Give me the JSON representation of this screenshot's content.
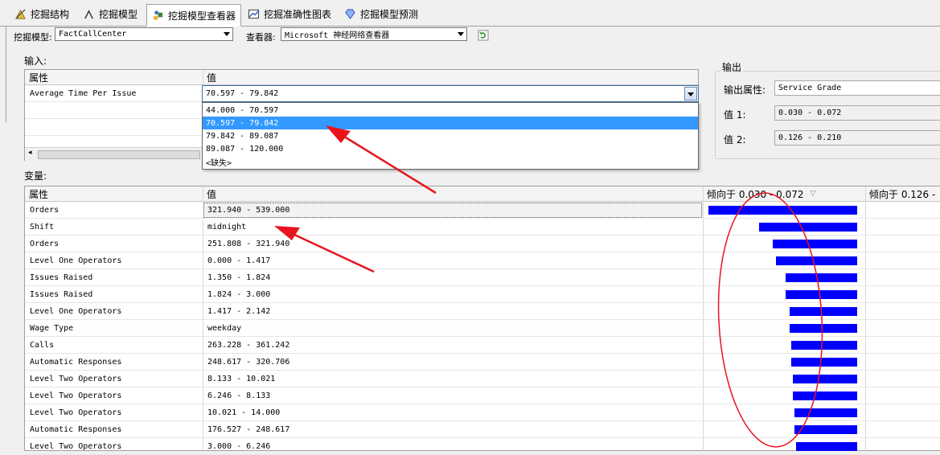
{
  "tabs": [
    {
      "label": "挖掘结构",
      "icon": "structure-icon"
    },
    {
      "label": "挖掘模型",
      "icon": "model-icon"
    },
    {
      "label": "挖掘模型查看器",
      "icon": "viewer-icon"
    },
    {
      "label": "挖掘准确性图表",
      "icon": "chart-icon"
    },
    {
      "label": "挖掘模型预测",
      "icon": "prediction-icon"
    }
  ],
  "toolbar": {
    "model_label": "挖掘模型:",
    "model_value": "FactCallCenter",
    "viewer_label": "查看器:",
    "viewer_value": "Microsoft 神经网络查看器"
  },
  "input": {
    "section_label": "输入:",
    "col_attr": "属性",
    "col_value": "值",
    "rows": [
      {
        "attr": "Average Time Per Issue",
        "value": "70.597 - 79.842"
      }
    ],
    "dropdown_options": [
      "44.000 - 70.597",
      "70.597 - 79.842",
      "79.842 - 89.087",
      "89.087 - 120.000",
      "<缺失>"
    ],
    "dropdown_selected_index": 1
  },
  "output": {
    "section_label": "输出",
    "attr_label": "输出属性:",
    "attr_value": "Service Grade",
    "value1_label": "值 1:",
    "value1": "0.030 - 0.072",
    "value2_label": "值 2:",
    "value2": "0.126 - 0.210"
  },
  "variables": {
    "section_label": "变量:",
    "col_attr": "属性",
    "col_value": "值",
    "col_favors1": "倾向于 0.030 - 0.072",
    "col_favors2": "倾向于 0.126 -",
    "rows": [
      {
        "attr": "Orders",
        "value": "321.940 - 539.000",
        "score": 0.9
      },
      {
        "attr": "Shift",
        "value": "midnight",
        "score": 0.59
      },
      {
        "attr": "Orders",
        "value": "251.808 - 321.940",
        "score": 0.51
      },
      {
        "attr": "Level One Operators",
        "value": "0.000 - 1.417",
        "score": 0.49
      },
      {
        "attr": "Issues Raised",
        "value": "1.350 - 1.824",
        "score": 0.43
      },
      {
        "attr": "Issues Raised",
        "value": "1.824 - 3.000",
        "score": 0.43
      },
      {
        "attr": "Level One Operators",
        "value": "1.417 - 2.142",
        "score": 0.41
      },
      {
        "attr": "Wage Type",
        "value": "weekday",
        "score": 0.41
      },
      {
        "attr": "Calls",
        "value": "263.228 - 361.242",
        "score": 0.4
      },
      {
        "attr": "Automatic Responses",
        "value": "248.617 - 320.706",
        "score": 0.4
      },
      {
        "attr": "Level Two Operators",
        "value": "8.133 - 10.021",
        "score": 0.39
      },
      {
        "attr": "Level Two Operators",
        "value": "6.246 - 8.133",
        "score": 0.39
      },
      {
        "attr": "Level Two Operators",
        "value": "10.021 - 14.000",
        "score": 0.38
      },
      {
        "attr": "Automatic Responses",
        "value": "176.527 - 248.617",
        "score": 0.38
      },
      {
        "attr": "Level Two Operators",
        "value": "3.000 - 6.246",
        "score": 0.37
      }
    ]
  },
  "colors": {
    "bar": "#0000ff",
    "selection": "#3399ff",
    "annotation": "#e8141e"
  }
}
